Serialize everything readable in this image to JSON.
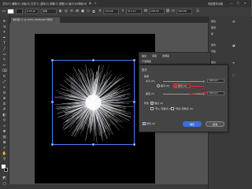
{
  "menubar": {
    "items": [
      "文件(F)",
      "编辑(E)",
      "对象(O)",
      "文字(T)",
      "选择(S)",
      "效果(C)",
      "视图(V)",
      "窗口(W)",
      "帮助(H)"
    ],
    "workspace": "传统基本功能"
  },
  "controlbar": {
    "stroke_value": "0.25 pt",
    "style_label": "基本",
    "opacity_label": "不透明度",
    "opacity_value": "100%",
    "x_value": "170.36",
    "y_value": "217.11",
    "w_value": "158.78",
    "h_value": "162.08"
  },
  "document": {
    "tab_label": "未标题-1* @ 100% (RGB/GPU 预览)"
  },
  "right_panel": {
    "items": [
      "属性",
      "图层",
      "库",
      "颜色",
      "色板",
      "描边",
      "渐变",
      "透明度",
      "外观"
    ]
  },
  "mid_panel": {
    "tabs": [
      "描边",
      "渐变",
      "透明度"
    ],
    "opacity_label": "不透明度"
  },
  "dialog": {
    "title": "扭拧",
    "amount_label": "数量",
    "horizontal_label": "水平 (H)",
    "horizontal_value": "100 pm",
    "vertical_label": "垂直 (V)",
    "vertical_value": "100 pm",
    "relative_label": "相对 (R)",
    "absolute_label": "绝对 (A)",
    "modify_label": "修改",
    "anchor_label": "锚点 (A)",
    "in_handle_label": "\"导入\"控制点 (I)",
    "out_handle_label": "\"导出\"控制点 (O)",
    "preview_label": "预览 (P)",
    "ok_label": "确定",
    "cancel_label": "取消"
  },
  "colors": {
    "accent": "#3b6fd8",
    "danger": "#e03030",
    "artboard": "#000000",
    "selection": "#4a7cff"
  }
}
